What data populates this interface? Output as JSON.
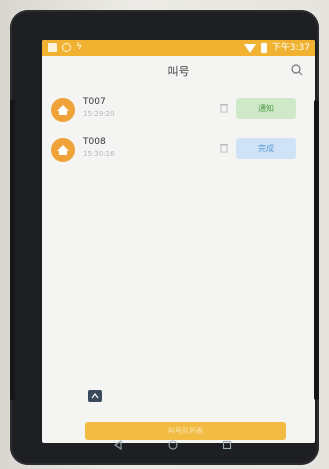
{
  "status_bar": {
    "time": "下午3:37",
    "icons": [
      "app-square-icon",
      "circle-icon",
      "bolt-icon",
      "wifi-icon",
      "battery-icon"
    ]
  },
  "header": {
    "title": "叫号",
    "search_icon": "search-icon"
  },
  "list": {
    "items": [
      {
        "code": "T007",
        "time": "15:29:20",
        "action_label": "通知",
        "action_type": "notify"
      },
      {
        "code": "T008",
        "time": "15:30:16",
        "action_label": "完成",
        "action_type": "done"
      }
    ]
  },
  "footer": {
    "button_label": "叫号队列表"
  },
  "colors": {
    "status_bar": "#f1b232",
    "avatar": "#f0a23a",
    "notify_bg": "#cfe9c8",
    "notify_text": "#4a9b46",
    "done_bg": "#cfe2f6",
    "done_text": "#5b9ad8",
    "bottom_button": "#f2bc42"
  },
  "device_nav": [
    "back-icon",
    "home-icon",
    "recent-apps-icon"
  ]
}
